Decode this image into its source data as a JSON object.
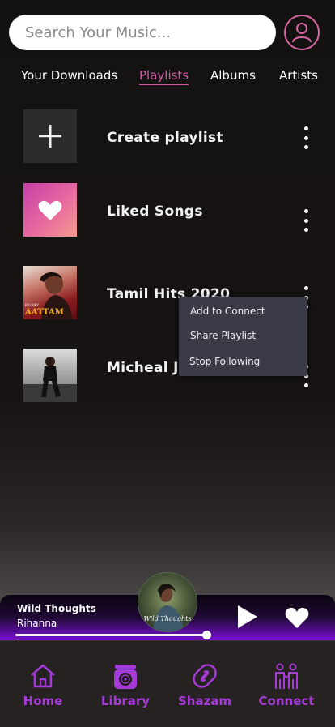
{
  "search": {
    "placeholder": "Search Your Music..."
  },
  "tabs": [
    {
      "label": "Your Downloads",
      "active": false
    },
    {
      "label": "Playlists",
      "active": true
    },
    {
      "label": "Albums",
      "active": false
    },
    {
      "label": "Artists",
      "active": false
    }
  ],
  "playlists": [
    {
      "title": "Create playlist",
      "icon": "plus-icon"
    },
    {
      "title": "Liked Songs",
      "icon": "heart-icon"
    },
    {
      "title": "Tamil Hits 2020",
      "cover_text_top": "BALAIKY",
      "cover_text": "AATTAM"
    },
    {
      "title": "Micheal Jackson"
    }
  ],
  "context_menu": {
    "items": [
      "Add to Connect",
      "Share Playlist",
      "Stop Following"
    ]
  },
  "now_playing": {
    "title": "Wild Thoughts",
    "artist": "Rihanna",
    "album_text": "Wild Thoughts",
    "progress": 0.92
  },
  "nav": [
    {
      "label": "Home",
      "icon": "home-icon"
    },
    {
      "label": "Library",
      "icon": "library-icon"
    },
    {
      "label": "Shazam",
      "icon": "shazam-icon"
    },
    {
      "label": "Connect",
      "icon": "connect-icon"
    }
  ],
  "colors": {
    "accent": "#d45aa6",
    "nav_purple": "#a53bd6",
    "player_gradient_end": "#7a0fd6",
    "menu_bg": "#3a3b46"
  }
}
